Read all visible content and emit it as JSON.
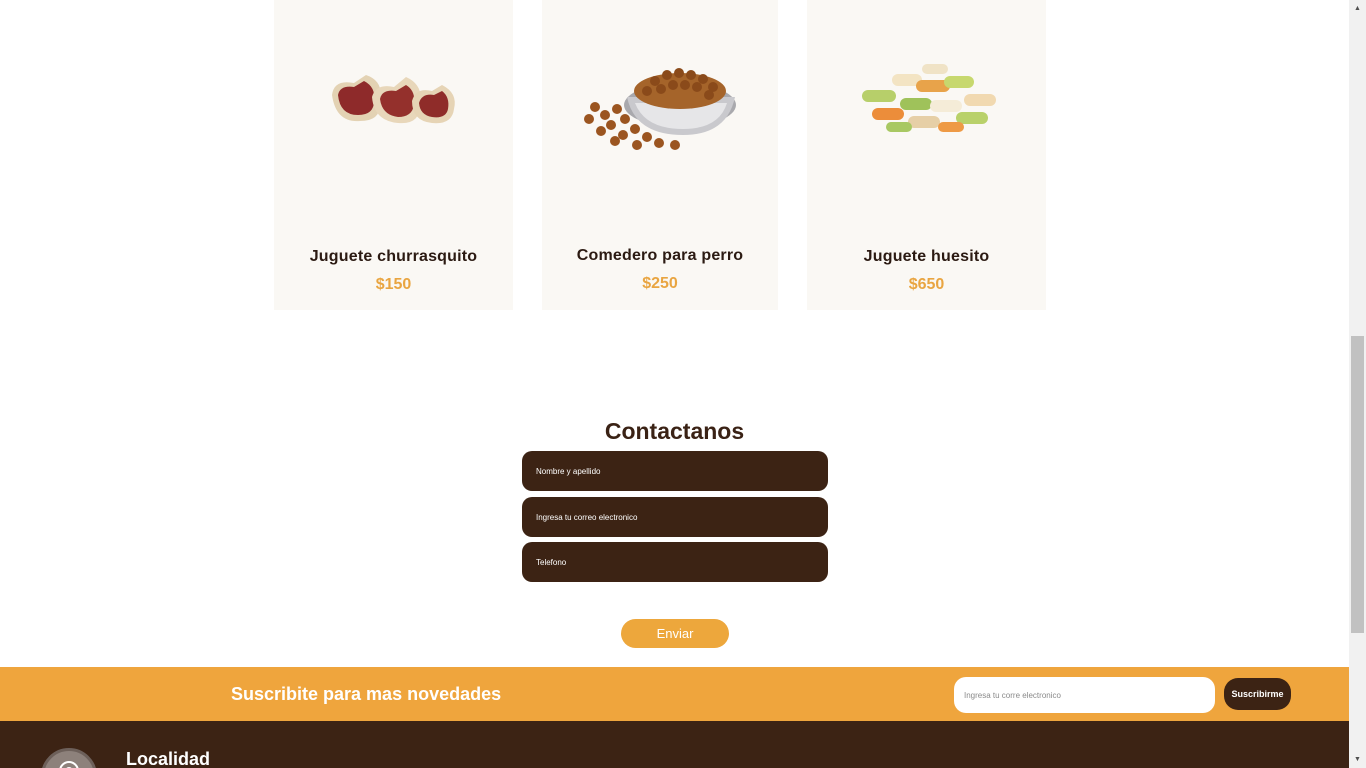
{
  "products": [
    {
      "name": "Juguete churrasquito",
      "price": "$150",
      "icon": "steak-treat-image"
    },
    {
      "name": "Comedero para perro",
      "price": "$250",
      "icon": "dog-food-bowl-image"
    },
    {
      "name": "Juguete huesito",
      "price": "$650",
      "icon": "bone-biscuits-image"
    }
  ],
  "contact": {
    "title": "Contactanos",
    "name_placeholder": "Nombre y apellido",
    "email_placeholder": "Ingresa tu correo electronico",
    "phone_placeholder": "Telefono",
    "send_label": "Enviar"
  },
  "newsletter": {
    "text": "Suscribite para mas novedades",
    "input_placeholder": "Ingresa tu corre electronico",
    "button_label": "Suscribirme"
  },
  "footer": {
    "location_title": "Localidad",
    "location_icon": "location-pin-icon"
  },
  "colors": {
    "brown": "#3c2314",
    "orange": "#efa53d",
    "card_bg": "#faf8f4"
  }
}
